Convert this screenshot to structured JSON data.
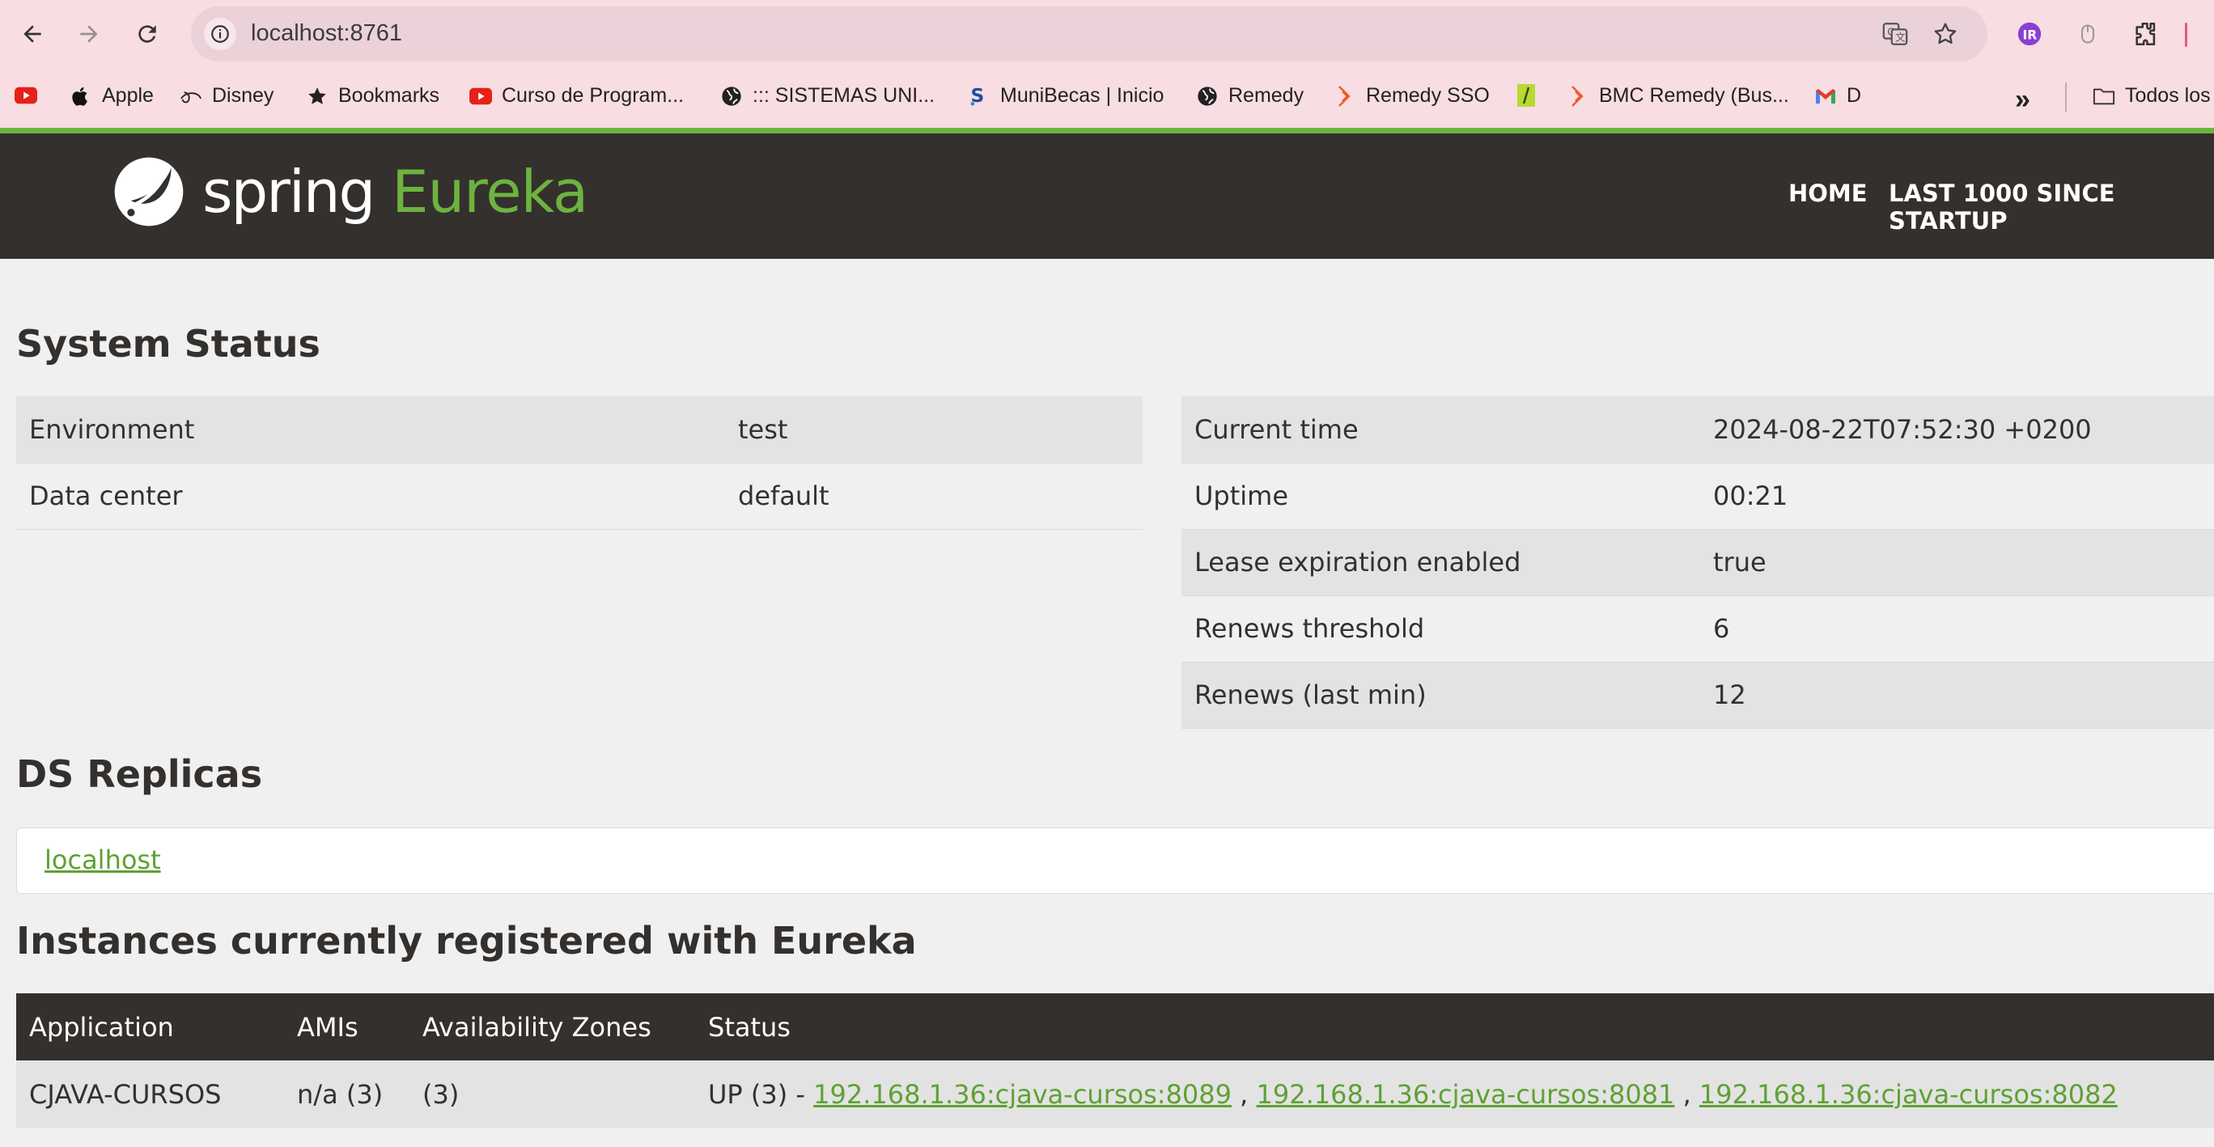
{
  "browser": {
    "url": "localhost:8761",
    "nav": {
      "back": "arrow-left",
      "forward": "arrow-right",
      "reload": "reload"
    },
    "bookmarks": [
      {
        "label": "",
        "icon": "youtube-icon"
      },
      {
        "label": "Apple",
        "icon": "apple-icon"
      },
      {
        "label": "Disney",
        "icon": "disney-icon"
      },
      {
        "label": "Bookmarks",
        "icon": "star-icon"
      },
      {
        "label": "Curso de Program...",
        "icon": "youtube-icon"
      },
      {
        "label": "::: SISTEMAS UNI...",
        "icon": "globe-icon"
      },
      {
        "label": "MuniBecas | Inicio",
        "icon": "munibecas-icon"
      },
      {
        "label": "Remedy",
        "icon": "globe-icon"
      },
      {
        "label": "Remedy SSO",
        "icon": "bmc-icon"
      },
      {
        "label": "",
        "icon": "slash-icon"
      },
      {
        "label": "BMC Remedy (Bus...",
        "icon": "bmc-icon"
      },
      {
        "label": "D",
        "icon": "gmail-icon"
      }
    ],
    "more_bookmarks": "»",
    "all_bookmarks": "Todos los"
  },
  "header": {
    "logo_spring": "spring",
    "logo_eureka": "Eureka",
    "nav": [
      "HOME",
      "LAST 1000 SINCE STARTUP"
    ]
  },
  "system_status": {
    "title": "System Status",
    "left": [
      {
        "label": "Environment",
        "value": "test"
      },
      {
        "label": "Data center",
        "value": "default"
      }
    ],
    "right": [
      {
        "label": "Current time",
        "value": "2024-08-22T07:52:30 +0200"
      },
      {
        "label": "Uptime",
        "value": "00:21"
      },
      {
        "label": "Lease expiration enabled",
        "value": "true"
      },
      {
        "label": "Renews threshold",
        "value": "6"
      },
      {
        "label": "Renews (last min)",
        "value": "12"
      }
    ]
  },
  "ds_replicas": {
    "title": "DS Replicas",
    "items": [
      "localhost"
    ]
  },
  "instances": {
    "title": "Instances currently registered with Eureka",
    "columns": [
      "Application",
      "AMIs",
      "Availability Zones",
      "Status"
    ],
    "rows": [
      {
        "application": "CJAVA-CURSOS",
        "amis": "n/a (3)",
        "zones": "(3)",
        "status_prefix": "UP (3) - ",
        "links": [
          "192.168.1.36:cjava-cursos:8089",
          "192.168.1.36:cjava-cursos:8081",
          "192.168.1.36:cjava-cursos:8082"
        ],
        "separator": " , "
      }
    ]
  },
  "colors": {
    "brand_green": "#6db33f",
    "header_dark": "#34302d",
    "link_green": "#5fa134",
    "chrome_pink": "#f8dde3"
  }
}
